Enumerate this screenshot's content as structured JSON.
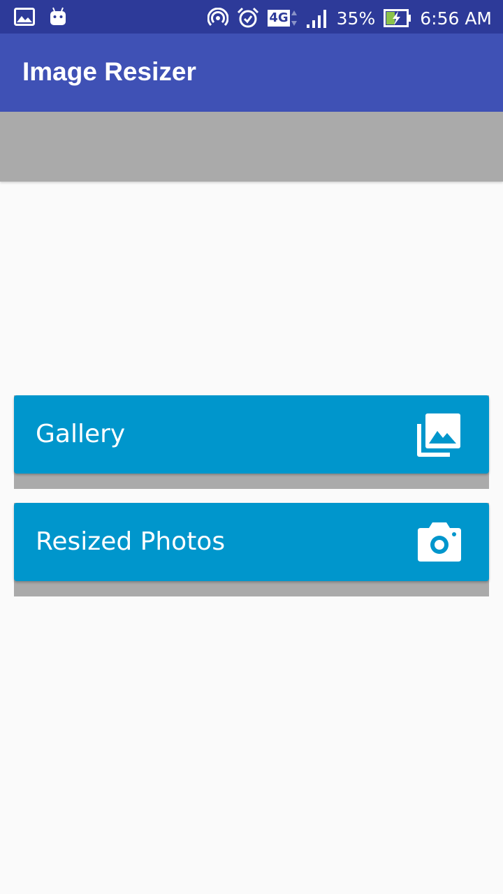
{
  "status_bar": {
    "icons_left": [
      "image-notification-icon",
      "android-notification-icon"
    ],
    "icons_right": [
      "hotspot-icon",
      "alarm-icon",
      "network-4g-icon",
      "signal-icon",
      "battery-charging-icon"
    ],
    "network_type": "4G",
    "battery_percent": "35%",
    "time": "6:56 AM"
  },
  "app_bar": {
    "title": "Image Resizer",
    "color": "#3f51b5"
  },
  "buttons": [
    {
      "label": "Gallery",
      "icon": "gallery-icon",
      "color": "#0096cc"
    },
    {
      "label": "Resized Photos",
      "icon": "camera-icon",
      "color": "#0096cc"
    }
  ],
  "colors": {
    "status_bar": "#2d3a99",
    "background": "#fafafa",
    "placeholder": "#aaaaaa"
  }
}
